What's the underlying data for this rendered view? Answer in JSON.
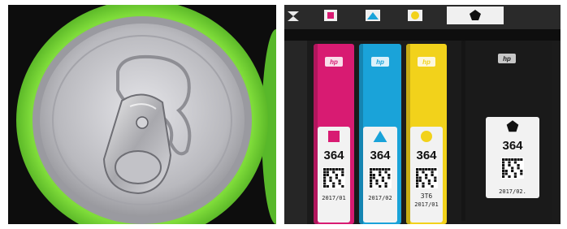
{
  "photos": [
    {
      "subject": "beverage-can-top"
    },
    {
      "subject": "ink-cartridges"
    }
  ],
  "cartridges": [
    {
      "color": "#d81b72",
      "shape": "square",
      "brand": "hp",
      "number": "364",
      "date": "2017/01",
      "code": ""
    },
    {
      "color": "#1aa3d9",
      "shape": "triangle",
      "brand": "hp",
      "number": "364",
      "date": "2017/02",
      "code": ""
    },
    {
      "color": "#f2d21b",
      "shape": "circle",
      "brand": "hp",
      "number": "364",
      "date": "2017/01",
      "code": "3T6"
    },
    {
      "color": "#1a1a1a",
      "shape": "pentagon",
      "brand": "hp",
      "number": "364",
      "date": "2017/02.",
      "code": ""
    }
  ],
  "colors": {
    "can_green": "#5cc52a",
    "can_silver": "#c8c8cc",
    "label_white": "#f2f2f2"
  }
}
